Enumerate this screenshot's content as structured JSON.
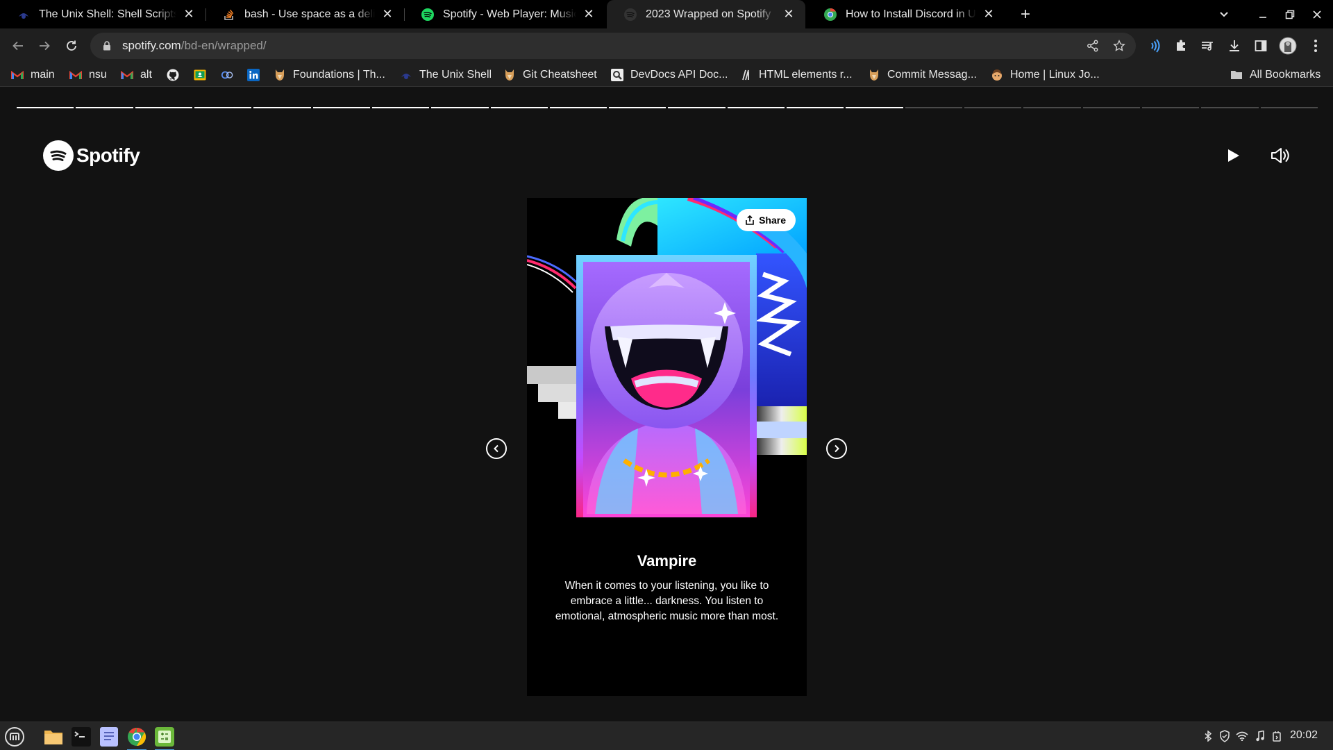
{
  "tabs": [
    {
      "title": "The Unix Shell: Shell Scripts",
      "icon": "carpentries-icon",
      "active": false
    },
    {
      "title": "bash - Use space as a delimiter",
      "icon": "stackoverflow-icon",
      "active": false
    },
    {
      "title": "Spotify - Web Player: Music for everyone",
      "icon": "spotify-icon",
      "active": false
    },
    {
      "title": "2023 Wrapped on Spotify",
      "icon": "spotify-dark-icon",
      "active": true
    },
    {
      "title": "How to Install Discord in Ubuntu",
      "icon": "chrome-icon",
      "active": false
    }
  ],
  "address_bar": {
    "domain": "spotify.com",
    "path": "/bd-en/wrapped/"
  },
  "bookmarks": [
    {
      "label": "main",
      "icon": "gmail-icon"
    },
    {
      "label": "nsu",
      "icon": "gmail-icon"
    },
    {
      "label": "alt",
      "icon": "gmail-icon"
    },
    {
      "label": "",
      "icon": "github-icon"
    },
    {
      "label": "",
      "icon": "classroom-icon"
    },
    {
      "label": "",
      "icon": "coursera-icon"
    },
    {
      "label": "",
      "icon": "linkedin-icon"
    },
    {
      "label": "Foundations | Th...",
      "icon": "odin-icon"
    },
    {
      "label": "The Unix Shell",
      "icon": "carpentries-icon"
    },
    {
      "label": "Git Cheatsheet",
      "icon": "odin-icon"
    },
    {
      "label": "DevDocs API Doc...",
      "icon": "devdocs-icon"
    },
    {
      "label": "HTML elements r...",
      "icon": "mdn-icon"
    },
    {
      "label": "Commit Messag...",
      "icon": "odin-icon"
    },
    {
      "label": "Home | Linux Jo...",
      "icon": "linux-journey-icon"
    }
  ],
  "all_bookmarks_label": "All Bookmarks",
  "wrapped": {
    "brand": "Spotify",
    "share_label": "Share",
    "story_title": "Vampire",
    "story_description": "When it comes to your listening, you like to embrace a little... darkness. You listen to emotional, atmospheric music more than most.",
    "progress_segments_total": 22,
    "progress_segments_done": 15
  },
  "taskbar": {
    "time": "20:02"
  },
  "colors": {
    "spotify_green": "#1ed760",
    "page_bg": "#121212",
    "card_bg": "#000000"
  }
}
